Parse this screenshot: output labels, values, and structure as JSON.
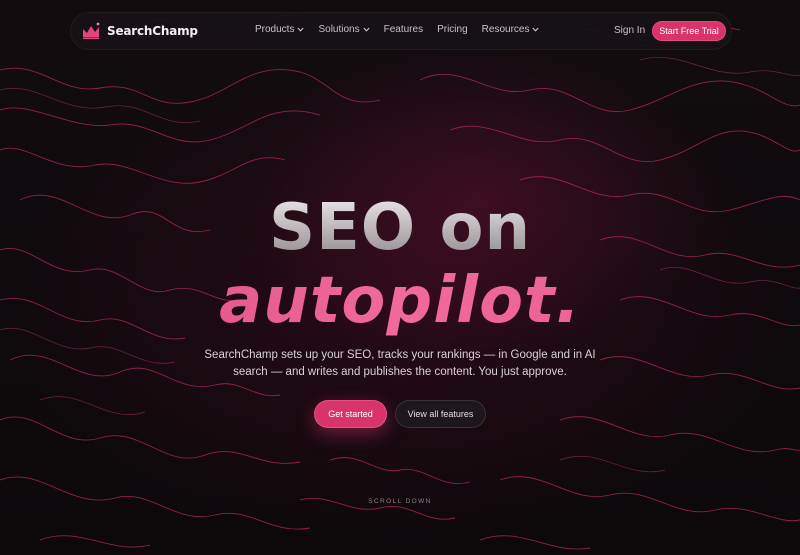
{
  "brand": {
    "name": "SearchChamp",
    "accent": "#d8336a"
  },
  "nav": {
    "items": [
      {
        "label": "Products",
        "has_dropdown": true
      },
      {
        "label": "Solutions",
        "has_dropdown": true
      },
      {
        "label": "Features",
        "has_dropdown": false
      },
      {
        "label": "Pricing",
        "has_dropdown": false
      },
      {
        "label": "Resources",
        "has_dropdown": true
      }
    ],
    "sign_in": "Sign In",
    "cta": "Start Free Trial"
  },
  "hero": {
    "headline_line1": "SEO on",
    "headline_line2": "autopilot.",
    "subtitle": "SearchChamp sets up your SEO, tracks your rankings — in Google and in AI search — and writes and publishes the content. You just approve.",
    "primary_button": "Get started",
    "secondary_button": "View all features",
    "scroll_hint": "SCROLL DOWN"
  },
  "icons": {
    "logo": "crown-chart-icon",
    "dropdown": "chevron-down-icon"
  }
}
